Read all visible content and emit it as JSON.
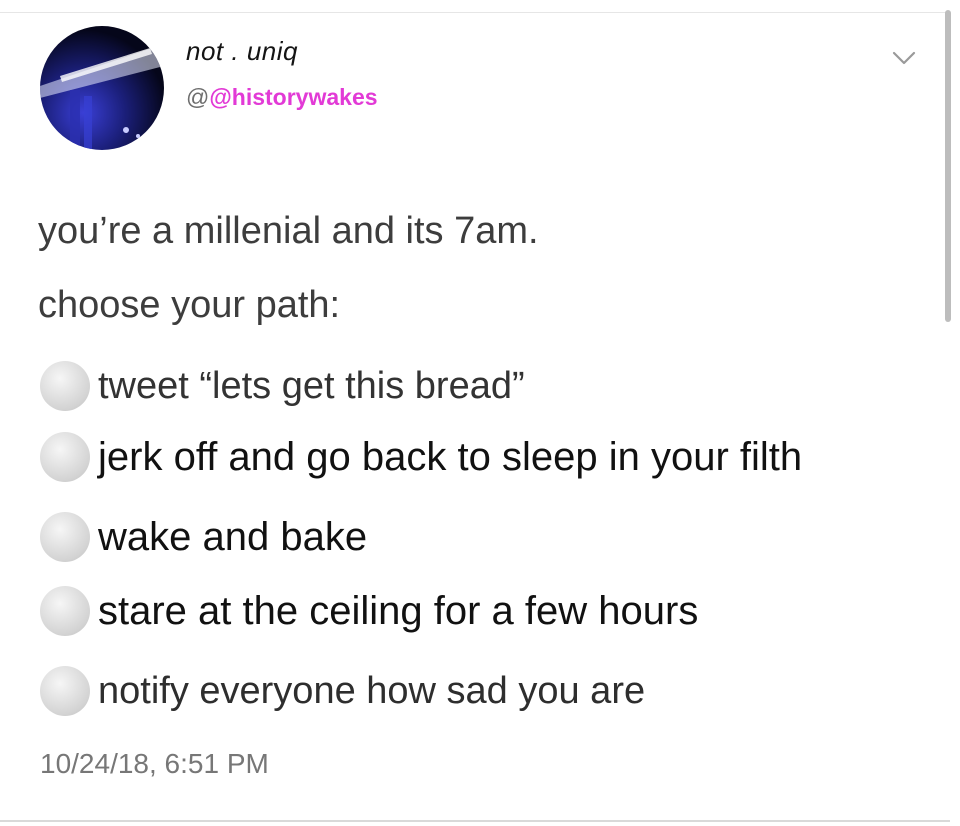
{
  "author": {
    "display_name": "not . uniq",
    "handle_prefix": "@",
    "handle": "@historywakes"
  },
  "tweet": {
    "lines": [
      "you’re a millenial and its 7am.",
      "choose your path:"
    ],
    "options": [
      "tweet “lets get this bread”",
      "jerk off and go back to sleep in your filth",
      "wake and bake",
      "stare at the ceiling for a few hours",
      "notify everyone how sad you are"
    ],
    "timestamp": "10/24/18, 6:51 PM"
  },
  "icons": {
    "menu": "chevron-down-icon",
    "option_marker": "radio-circle-icon"
  },
  "colors": {
    "handle_accent": "#e23ad6",
    "text_gray": "#3d3d3d",
    "timestamp_gray": "#777777"
  }
}
